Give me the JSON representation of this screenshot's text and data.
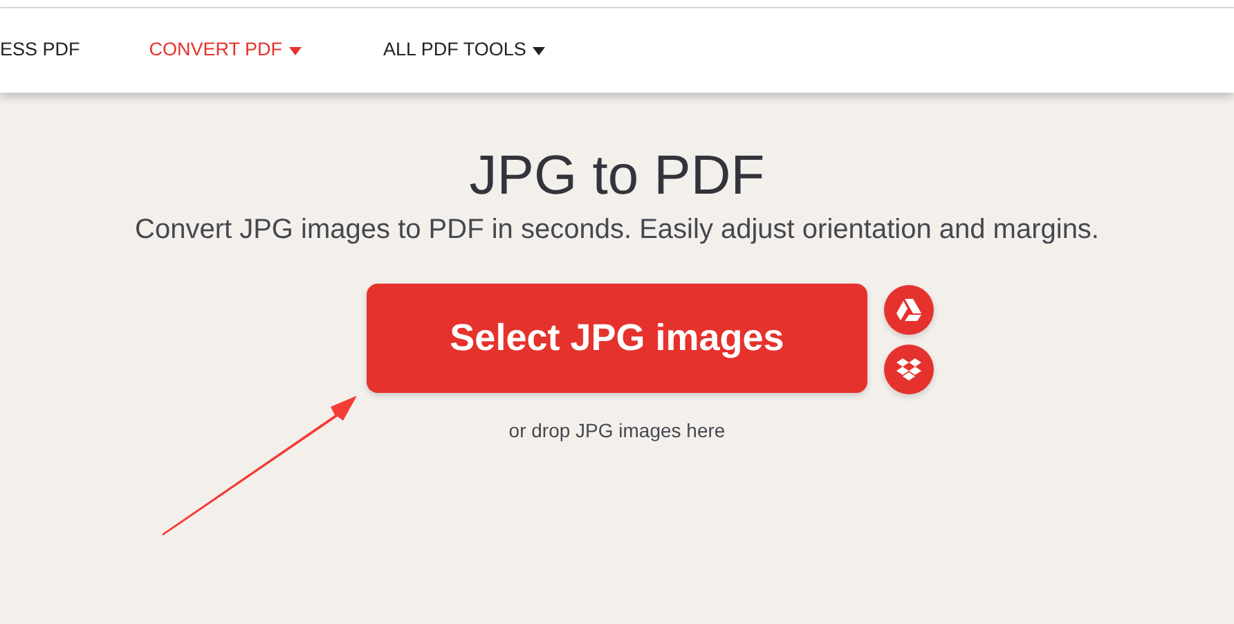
{
  "nav": {
    "items": [
      {
        "label": "ESS PDF",
        "selected": false,
        "dropdown": false
      },
      {
        "label": "CONVERT PDF",
        "selected": true,
        "dropdown": true
      },
      {
        "label": "ALL PDF TOOLS",
        "selected": false,
        "dropdown": true
      }
    ]
  },
  "hero": {
    "title": "JPG to PDF",
    "subtitle": "Convert JPG images to PDF in seconds. Easily adjust orientation and margins.",
    "button": "Select JPG images",
    "hint": "or drop JPG images here"
  }
}
